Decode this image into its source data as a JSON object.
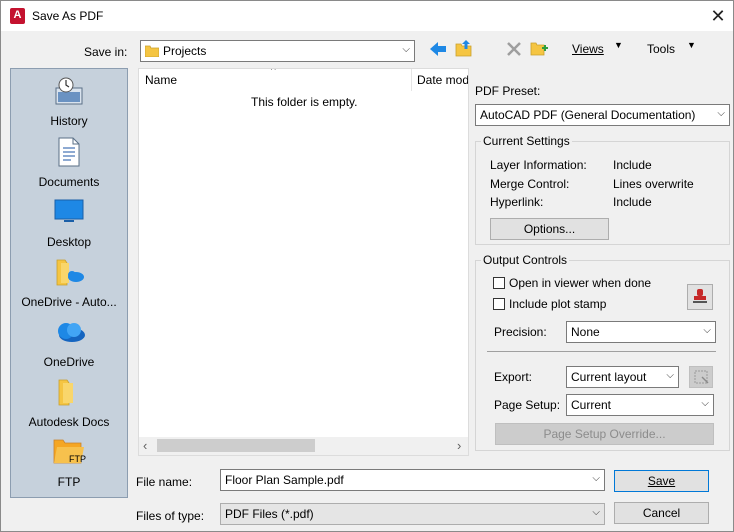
{
  "window": {
    "title": "Save As PDF",
    "app_icon_letter": "A"
  },
  "toolbar": {
    "save_in_label": "Save in:",
    "save_in_value": "Projects",
    "views_label": "Views",
    "tools_label": "Tools"
  },
  "places": [
    {
      "label": "History",
      "icon": "history-icon"
    },
    {
      "label": "Documents",
      "icon": "documents-icon"
    },
    {
      "label": "Desktop",
      "icon": "desktop-icon"
    },
    {
      "label": "OneDrive - Auto...",
      "icon": "onedrive-folder-icon"
    },
    {
      "label": "OneDrive",
      "icon": "onedrive-cloud-icon"
    },
    {
      "label": "Autodesk Docs",
      "icon": "autodesk-docs-folder-icon"
    },
    {
      "label": "FTP",
      "icon": "ftp-folder-icon",
      "badge": "FTP"
    }
  ],
  "file_list": {
    "columns": [
      "Name",
      "Date mod"
    ],
    "empty_message": "This folder is empty."
  },
  "pdf_preset": {
    "label": "PDF Preset:",
    "value": "AutoCAD PDF (General Documentation)"
  },
  "current_settings": {
    "title": "Current Settings",
    "rows": [
      {
        "key": "Layer Information:",
        "value": "Include"
      },
      {
        "key": "Merge Control:",
        "value": "Lines overwrite"
      },
      {
        "key": "Hyperlink:",
        "value": "Include"
      }
    ],
    "options_button": "Options..."
  },
  "output_controls": {
    "title": "Output Controls",
    "open_in_viewer_label": "Open in viewer when done",
    "open_in_viewer_checked": false,
    "plot_stamp_label": "Include plot stamp",
    "plot_stamp_checked": false,
    "precision_label": "Precision:",
    "precision_value": "None",
    "export_label": "Export:",
    "export_value": "Current layout",
    "page_setup_label": "Page Setup:",
    "page_setup_value": "Current",
    "page_setup_override_button": "Page Setup Override..."
  },
  "file_name": {
    "label": "File name:",
    "value": "Floor Plan Sample.pdf"
  },
  "file_type": {
    "label": "Files of type:",
    "value": "PDF Files (*.pdf)"
  },
  "buttons": {
    "save": "Save",
    "cancel": "Cancel"
  },
  "colors": {
    "accent_blue": "#1e88e5",
    "folder_yellow": "#f5c542",
    "places_bg": "#c6d1dc",
    "app_red": "#c4122f"
  }
}
